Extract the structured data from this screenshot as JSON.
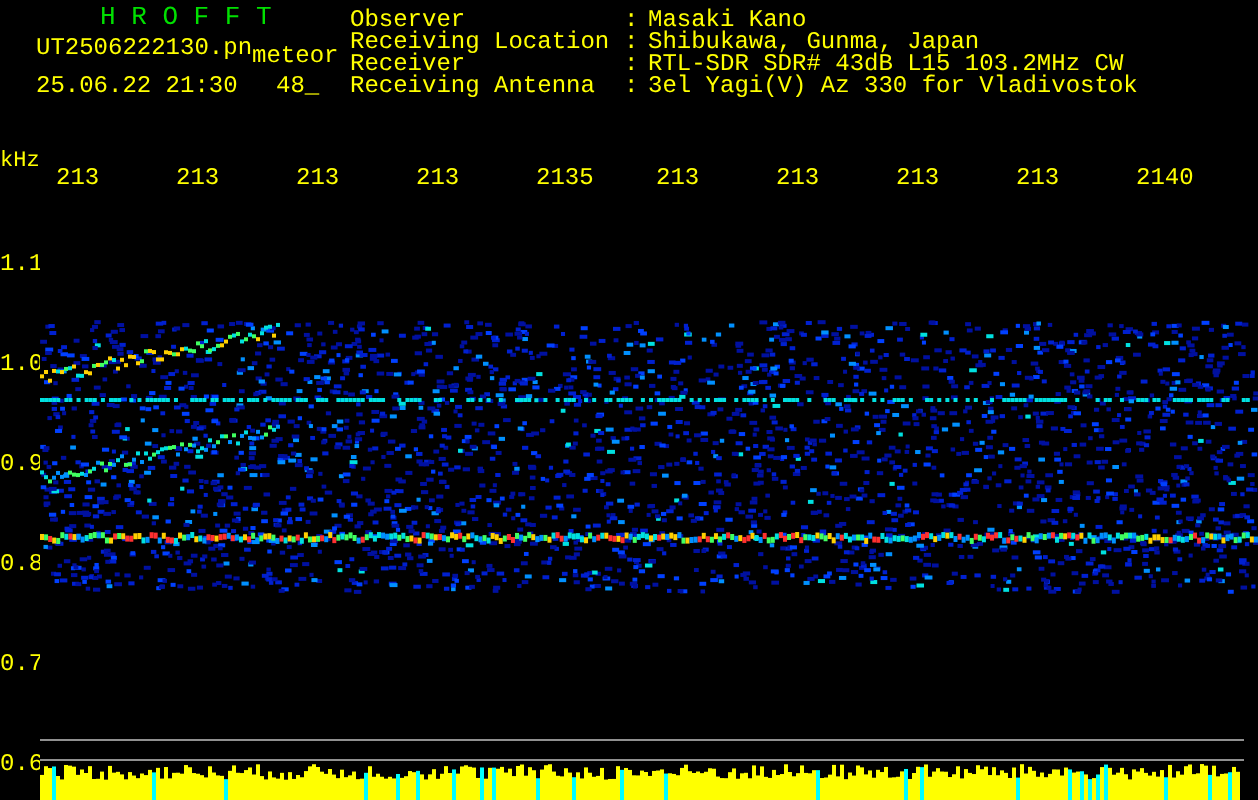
{
  "header": {
    "app_title": "H R O F F T",
    "file_name": "UT2506222130.pn",
    "mode": "meteor",
    "timestamp": "25.06.22 21:30",
    "count": "48_"
  },
  "info": [
    {
      "label": "Observer",
      "separator": ":",
      "value": "Masaki Kano"
    },
    {
      "label": "Receiving Location",
      "separator": ":",
      "value": "Shibukawa, Gunma, Japan"
    },
    {
      "label": "Receiver",
      "separator": ":",
      "value": "RTL-SDR SDR# 43dB L15 103.2MHz CW"
    },
    {
      "label": "Receiving Antenna",
      "separator": ":",
      "value": "3el Yagi(V) Az 330 for Vladivostok"
    }
  ],
  "spectrogram": {
    "y_unit": "kHz",
    "x_labels": [
      "213",
      "213",
      "213",
      "213",
      "2135",
      "213",
      "213",
      "213",
      "213",
      "2140"
    ],
    "y_labels": [
      "1.1",
      "1.0",
      "0.9",
      "0.8",
      "0.7",
      "0.6"
    ]
  }
}
